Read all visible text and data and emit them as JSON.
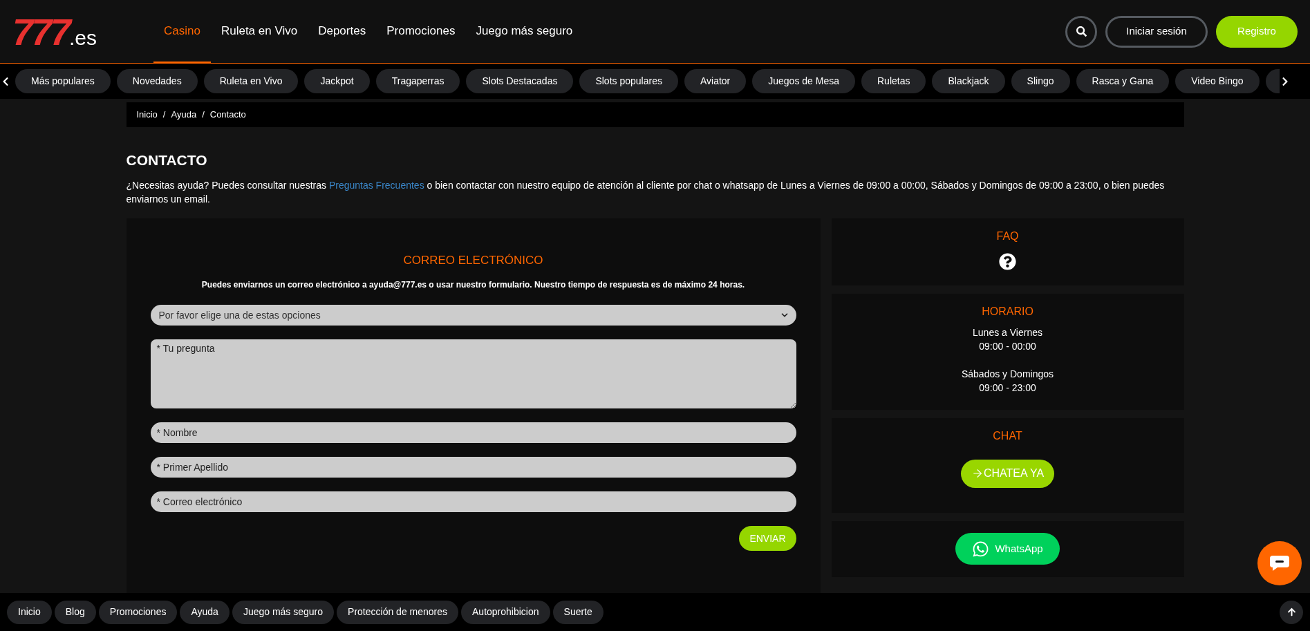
{
  "logo": {
    "main": "777",
    "suffix": ".es"
  },
  "nav": [
    {
      "label": "Casino",
      "selected": true
    },
    {
      "label": "Ruleta en Vivo",
      "selected": false
    },
    {
      "label": "Deportes",
      "selected": false
    },
    {
      "label": "Promociones",
      "selected": false
    },
    {
      "label": "Juego más seguro",
      "selected": false
    }
  ],
  "header_buttons": {
    "login": "Iniciar sesión",
    "register": "Registro"
  },
  "categories": [
    "Más populares",
    "Novedades",
    "Ruleta en Vivo",
    "Jackpot",
    "Tragaperras",
    "Slots Destacadas",
    "Slots populares",
    "Aviator",
    "Juegos de Mesa",
    "Ruletas",
    "Blackjack",
    "Slingo",
    "Rasca y Gana",
    "Video Bingo"
  ],
  "breadcrumb": {
    "separator": "/",
    "items": [
      "Inicio",
      "Ayuda",
      "Contacto"
    ]
  },
  "page_title": "CONTACTO",
  "intro": {
    "before": "¿Necesitas ayuda? Puedes consultar nuestras ",
    "link": "Preguntas Frecuentes",
    "after": " o bien contactar con nuestro equipo de atención al cliente por chat o whatsapp de Lunes a Viernes de 09:00 a 00:00, Sábados y Domingos de 09:00 a 23:00, o bien puedes enviarnos un email."
  },
  "email_form": {
    "title": "CORREO ELECTRÓNICO",
    "description": "Puedes enviarnos un correo electrónico a ayuda@777.es o usar nuestro formulario. Nuestro tiempo de respuesta es de máximo 24 horas.",
    "topic_select": {
      "value": "Por favor elige una de estas opciones"
    },
    "fields": [
      {
        "kind": "textarea",
        "placeholder": "* Tu pregunta"
      },
      {
        "kind": "input",
        "placeholder": "* Nombre"
      },
      {
        "kind": "input",
        "placeholder": "* Primer Apellido"
      },
      {
        "kind": "input",
        "placeholder": "* Correo electrónico"
      }
    ],
    "submit": "ENVIAR"
  },
  "faq": {
    "title": "FAQ"
  },
  "schedule": {
    "title": "HORARIO",
    "blocks": [
      {
        "days": "Lunes a Viernes",
        "hours": "09:00 - 00:00"
      },
      {
        "days": "Sábados y Domingos",
        "hours": "09:00 - 23:00"
      }
    ]
  },
  "chat": {
    "title": "CHAT",
    "button": "CHATEA YA"
  },
  "whatsapp": {
    "button": "WhatsApp"
  },
  "footer_links": [
    "Inicio",
    "Blog",
    "Promociones",
    "Ayuda",
    "Juego más seguro",
    "Protección de menores",
    "Autoprohibicion",
    "Suerte"
  ]
}
